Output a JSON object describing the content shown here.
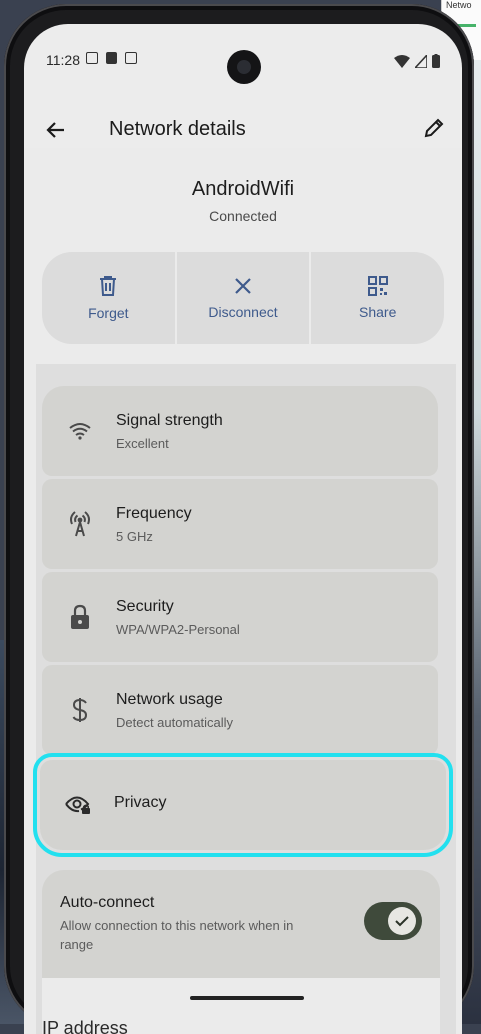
{
  "background": {
    "window_title": "Netwo"
  },
  "status_bar": {
    "time": "11:28"
  },
  "app_bar": {
    "title": "Network details"
  },
  "network": {
    "name": "AndroidWifi",
    "status": "Connected"
  },
  "actions": [
    {
      "label": "Forget",
      "icon": "trash-icon"
    },
    {
      "label": "Disconnect",
      "icon": "close-icon"
    },
    {
      "label": "Share",
      "icon": "qr-code-icon"
    }
  ],
  "details": [
    {
      "title": "Signal strength",
      "subtitle": "Excellent",
      "icon": "wifi-icon"
    },
    {
      "title": "Frequency",
      "subtitle": "5 GHz",
      "icon": "antenna-icon"
    },
    {
      "title": "Security",
      "subtitle": "WPA/WPA2-Personal",
      "icon": "lock-icon"
    },
    {
      "title": "Network usage",
      "subtitle": "Detect automatically",
      "icon": "dollar-icon"
    }
  ],
  "privacy": {
    "title": "Privacy",
    "icon": "eye-lock-icon"
  },
  "auto_connect": {
    "title": "Auto-connect",
    "subtitle": "Allow connection to this network when in range",
    "enabled": true
  },
  "ip": {
    "label": "IP address"
  },
  "colors": {
    "accent_blue": "#3e5a8c",
    "highlight": "#22e0ef",
    "toggle_on": "#3f4a3b"
  }
}
